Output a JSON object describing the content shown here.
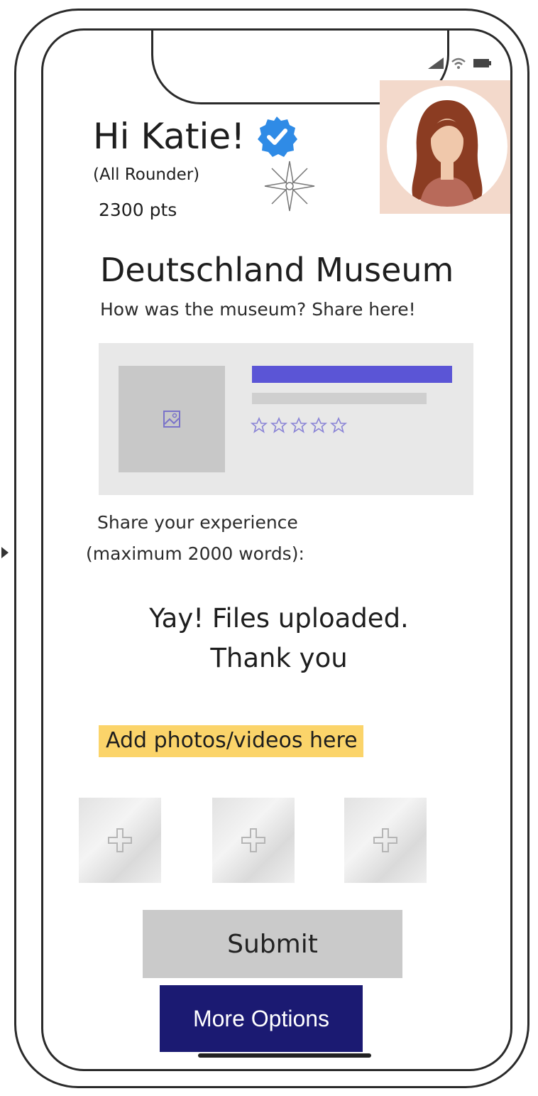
{
  "colors": {
    "accent_bar": "#5b55d6",
    "highlight": "#fbd46a",
    "more_options_bg": "#1b1a72",
    "submit_bg": "#cacaca",
    "verified_badge": "#2f8be6",
    "avatar_bg": "#f3d9cb"
  },
  "header": {
    "greeting": "Hi Katie!",
    "rank": "(All Rounder)",
    "points": "2300 pts",
    "icons": [
      "verified-badge-icon",
      "compass-star-icon",
      "signal-icon",
      "wifi-icon",
      "battery-icon"
    ]
  },
  "place": {
    "title": "Deutschland Museum",
    "subtitle": "How was the museum? Share here!"
  },
  "card": {
    "rating_stars": 5,
    "icons": [
      "image-placeholder-icon",
      "star-outline-icon"
    ]
  },
  "form": {
    "prompt_line1": "Share your experience",
    "prompt_line2": "(maximum 2000 words):",
    "status_line1": "Yay! Files uploaded.",
    "status_line2": "Thank you",
    "upload_label": "Add photos/videos here",
    "upload_tile_icon": "plus-icon"
  },
  "buttons": {
    "submit": "Submit",
    "more_options": "More Options"
  }
}
